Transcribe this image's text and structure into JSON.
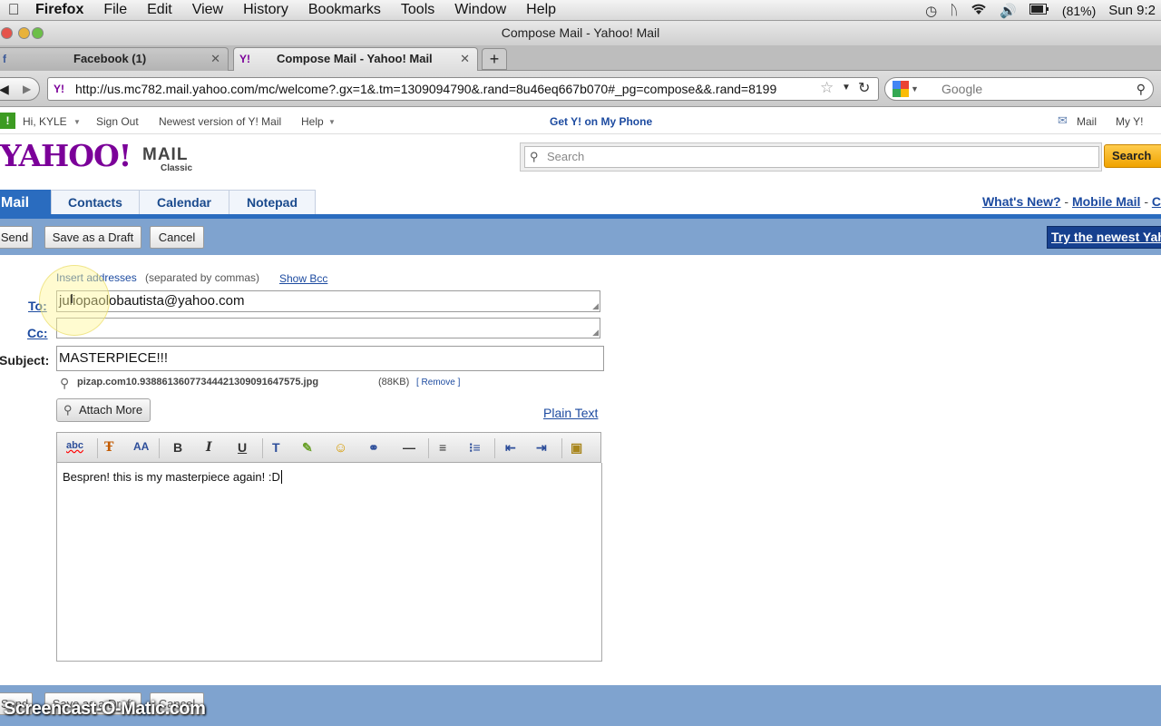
{
  "menubar": {
    "items": [
      "Firefox",
      "File",
      "Edit",
      "View",
      "History",
      "Bookmarks",
      "Tools",
      "Window",
      "Help"
    ],
    "battery": "(81%)",
    "clock": "Sun 9:2"
  },
  "window": {
    "title": "Compose Mail - Yahoo! Mail"
  },
  "tabs": [
    {
      "label": "Facebook (1)"
    },
    {
      "label": "Compose Mail - Yahoo! Mail"
    }
  ],
  "nav": {
    "url": "http://us.mc782.mail.yahoo.com/mc/welcome?.gx=1&.tm=1309094790&.rand=8u46eq667b070#_pg=compose&&.rand=8199",
    "search_placeholder": "Google"
  },
  "util": {
    "greeting": "Hi, KYLE",
    "signout": "Sign Out",
    "newest_version": "Newest version of Y! Mail",
    "help": "Help",
    "get_phone": "Get Y! on My Phone",
    "mail": "Mail",
    "my_y": "My Y!"
  },
  "brand": {
    "logo": "YAHOO!",
    "mail": "MAIL",
    "classic": "Classic"
  },
  "search": {
    "placeholder": "Search",
    "button": "Search"
  },
  "mail_tabs": [
    "Mail",
    "Contacts",
    "Calendar",
    "Notepad"
  ],
  "top_links": {
    "whats_new": "What's New?",
    "mobile_mail": "Mobile Mail"
  },
  "actions": {
    "send": "Send",
    "save_draft": "Save as a Draft",
    "cancel": "Cancel",
    "try_newest": "Try the newest Yah"
  },
  "compose": {
    "insert_addresses": "Insert addresses",
    "separated": "(separated by commas)",
    "show_bcc": "Show Bcc",
    "to_label": "To:",
    "to_value": "juliopaolobautista@yahoo.com",
    "cc_label": "Cc:",
    "cc_value": "",
    "subject_label": "Subject:",
    "subject_value": "MASTERPIECE!!!",
    "attachment_name": "pizap.com10.93886136077344421309091647575.jpg",
    "attachment_size": "(88KB)",
    "remove": "[ Remove ]",
    "attach_more": "Attach More",
    "plain_text": "Plain Text",
    "body": "Bespren! this is my masterpiece again! :D"
  },
  "watermark": "Screencast-O-Matic.com",
  "colors": {
    "yahoo_purple": "#7b0099",
    "tab_blue": "#2a6cbf",
    "bar_blue": "#7fa3cf",
    "link_blue": "#1d4ba0"
  }
}
